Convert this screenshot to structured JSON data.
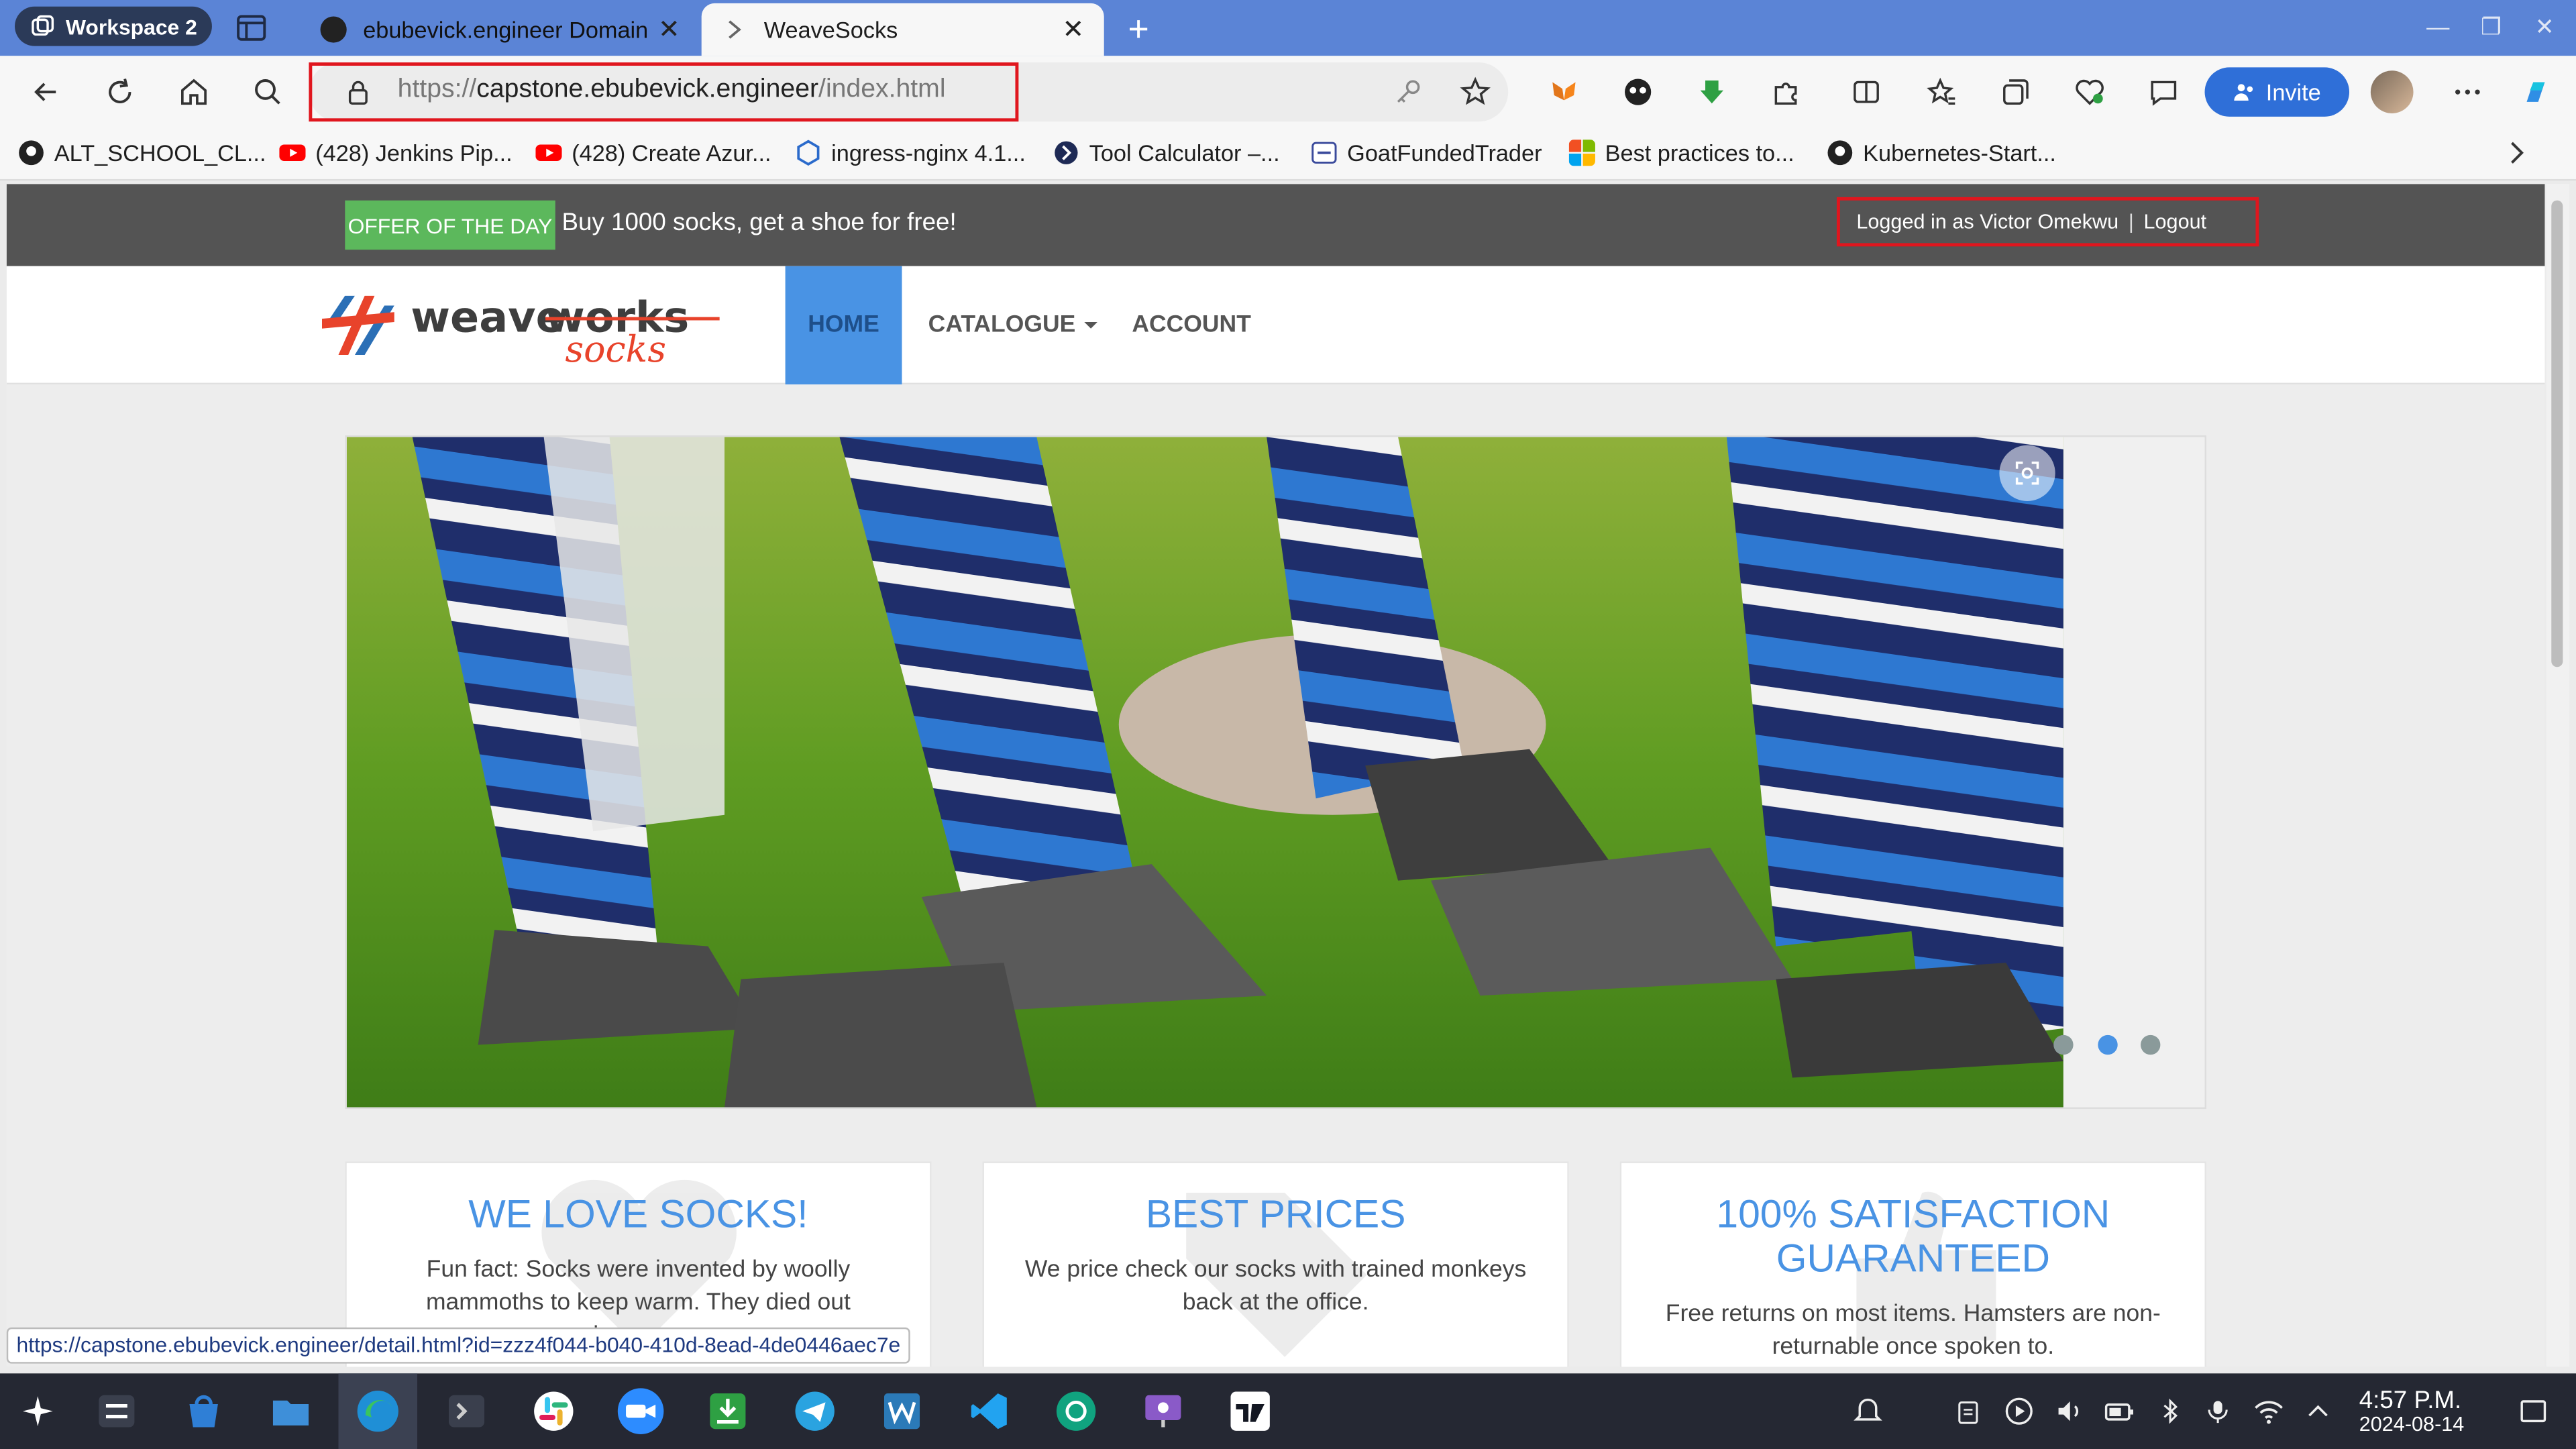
{
  "browser": {
    "workspace_label": "Workspace 2",
    "tabs": [
      {
        "title": "ebubevick.engineer Domain",
        "active": false
      },
      {
        "title": "WeaveSocks",
        "active": true
      }
    ],
    "new_tab": "+",
    "close_glyph": "✕",
    "address": {
      "scheme": "https://",
      "domain": "capstone.ebubevick.engineer",
      "path": "/index.html"
    },
    "invite_label": "Invite",
    "bookmarks": [
      {
        "label": "ALT_SCHOOL_CL...",
        "icon": "github-icon"
      },
      {
        "label": "(428) Jenkins Pip...",
        "icon": "youtube-icon"
      },
      {
        "label": "(428) Create Azur...",
        "icon": "youtube-icon"
      },
      {
        "label": "ingress-nginx 4.1...",
        "icon": "hexagon-icon"
      },
      {
        "label": "Tool Calculator –...",
        "icon": "tool-icon"
      },
      {
        "label": "GoatFundedTrader",
        "icon": "goat-icon"
      },
      {
        "label": "Best practices to...",
        "icon": "microsoft-icon"
      },
      {
        "label": "Kubernetes-Start...",
        "icon": "github-icon"
      }
    ],
    "status_url": "https://capstone.ebubevick.engineer/detail.html?id=zzz4f044-b040-410d-8ead-4de0446aec7e"
  },
  "site": {
    "offer_badge": "OFFER OF THE DAY",
    "offer_text": "Buy 1000 socks, get a shoe for free!",
    "logged_in": "Logged in as Victor Omekwu",
    "separator": "|",
    "logout": "Logout",
    "logo": {
      "weave": "weave",
      "works": "works",
      "socks": "socks"
    },
    "nav": {
      "home": "HOME",
      "catalogue": "CATALOGUE",
      "account": "ACCOUNT"
    },
    "carousel": {
      "slide_count": 3,
      "active_index": 1
    },
    "cards": [
      {
        "title": "WE LOVE SOCKS!",
        "text": "Fun fact: Socks were invented by woolly mammoths to keep warm. They died out because"
      },
      {
        "title": "BEST PRICES",
        "text": "We price check our socks with trained monkeys back at the office."
      },
      {
        "title": "100% SATISFACTION GUARANTEED",
        "text": "Free returns on most items. Hamsters are non-returnable once spoken to."
      }
    ],
    "colors": {
      "accent": "#4993e4",
      "offer_green": "#5cb85c",
      "topbar": "#545454",
      "highlight_red": "#e0161e"
    }
  },
  "taskbar": {
    "time": "4:57 P.M.",
    "date": "2024-08-14"
  }
}
